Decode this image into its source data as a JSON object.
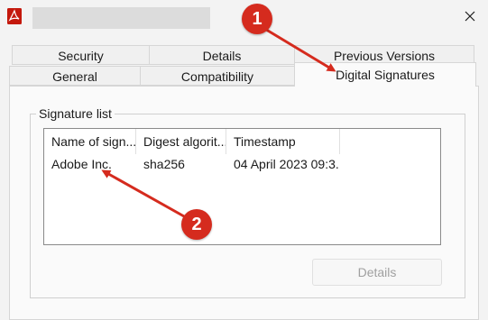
{
  "window": {
    "close_label": "✕",
    "accent_red": "#d52b1e"
  },
  "tabs": {
    "row_back": [
      "Security",
      "Details",
      "Previous Versions"
    ],
    "row_front": [
      "General",
      "Compatibility",
      "Digital Signatures"
    ],
    "active": "Digital Signatures"
  },
  "signature_group": {
    "legend": "Signature list",
    "columns": [
      "Name of sign...",
      "Digest algorit...",
      "Timestamp"
    ],
    "rows": [
      [
        "Adobe Inc.",
        "sha256",
        "04 April 2023 09:3..."
      ]
    ],
    "details_label": "Details"
  },
  "annotations": {
    "badge_1": "1",
    "badge_2": "2"
  }
}
